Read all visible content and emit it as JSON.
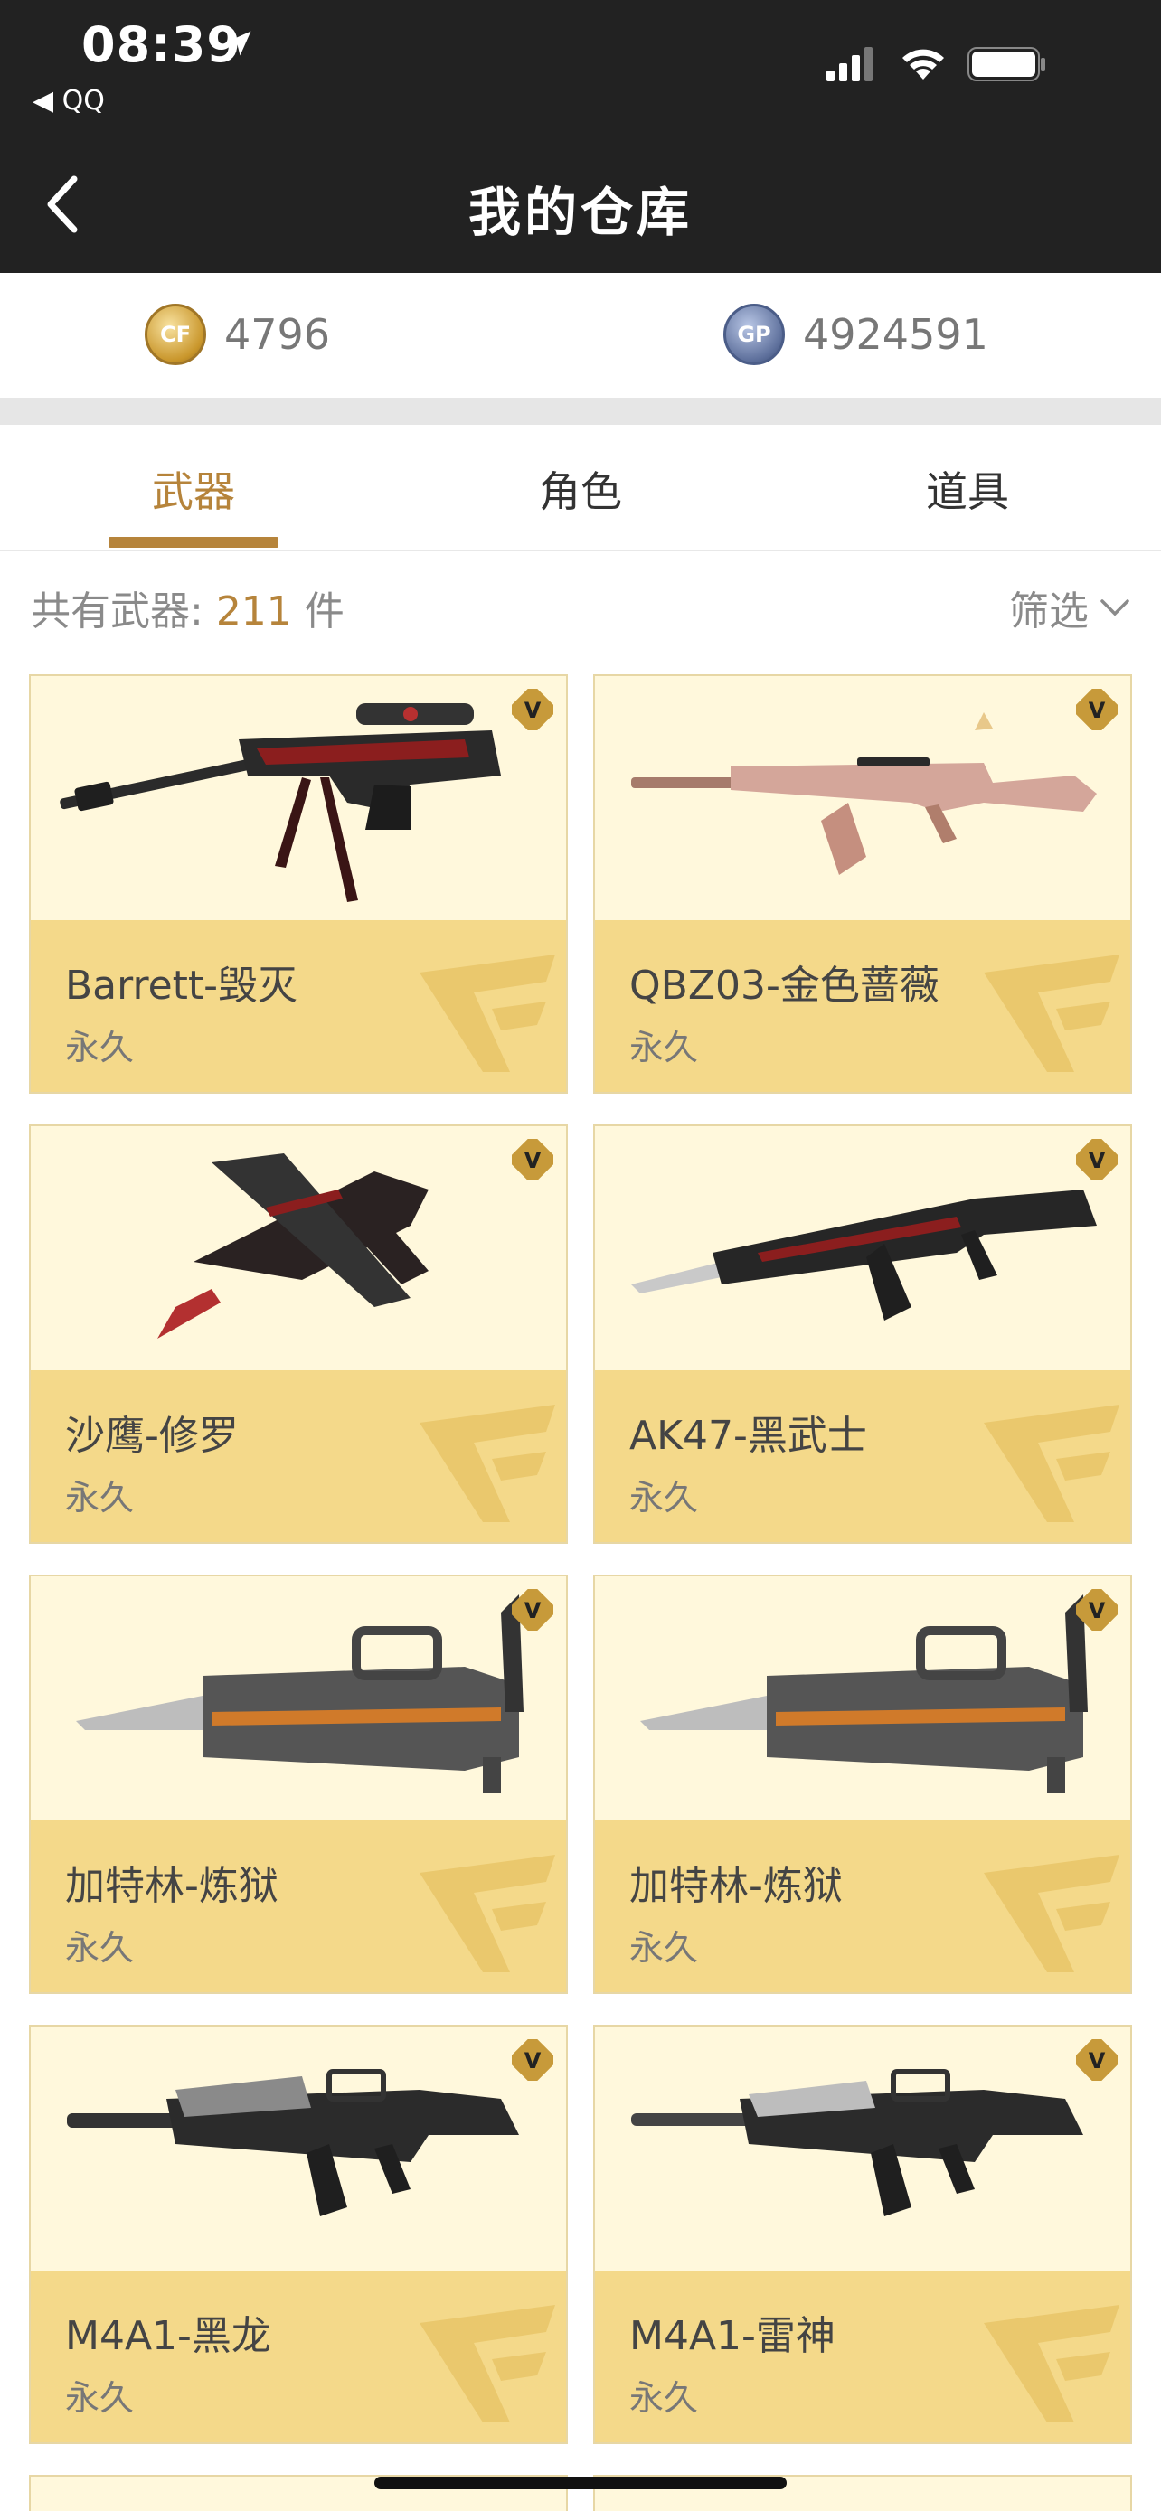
{
  "status_bar": {
    "time": "08:39",
    "back_app": "◀ QQ"
  },
  "nav": {
    "title": "我的仓库"
  },
  "currency": [
    {
      "icon": "cf-coin-icon",
      "coin_text": "CF",
      "value": "4796"
    },
    {
      "icon": "gp-coin-icon",
      "coin_text": "GP",
      "value": "4924591"
    }
  ],
  "tabs": [
    {
      "label": "武器",
      "active": true
    },
    {
      "label": "角色",
      "active": false
    },
    {
      "label": "道具",
      "active": false
    }
  ],
  "summary": {
    "prefix": "共有武器: ",
    "count": "211",
    "suffix": " 件",
    "filter_label": "筛选"
  },
  "items": [
    {
      "name": "Barrett-毁灭",
      "duration": "永久",
      "icon": "sniper-rifle-icon"
    },
    {
      "name": "QBZ03-金色蔷薇",
      "duration": "永久",
      "icon": "assault-rifle-icon"
    },
    {
      "name": "沙鹰-修罗",
      "duration": "永久",
      "icon": "pistol-icon"
    },
    {
      "name": "AK47-黑武士",
      "duration": "永久",
      "icon": "assault-rifle-icon"
    },
    {
      "name": "加特林-炼狱",
      "duration": "永久",
      "icon": "gatling-gun-icon"
    },
    {
      "name": "加特林-炼狱",
      "duration": "永久",
      "icon": "gatling-gun-icon"
    },
    {
      "name": "M4A1-黑龙",
      "duration": "永久",
      "icon": "assault-rifle-icon"
    },
    {
      "name": "M4A1-雷神",
      "duration": "永久",
      "icon": "assault-rifle-icon"
    }
  ],
  "colors": {
    "accent": "#b6843b",
    "card_info_bg": "#f4d98a",
    "card_img_bg": "#fff8dc",
    "header_bg": "#222222"
  }
}
